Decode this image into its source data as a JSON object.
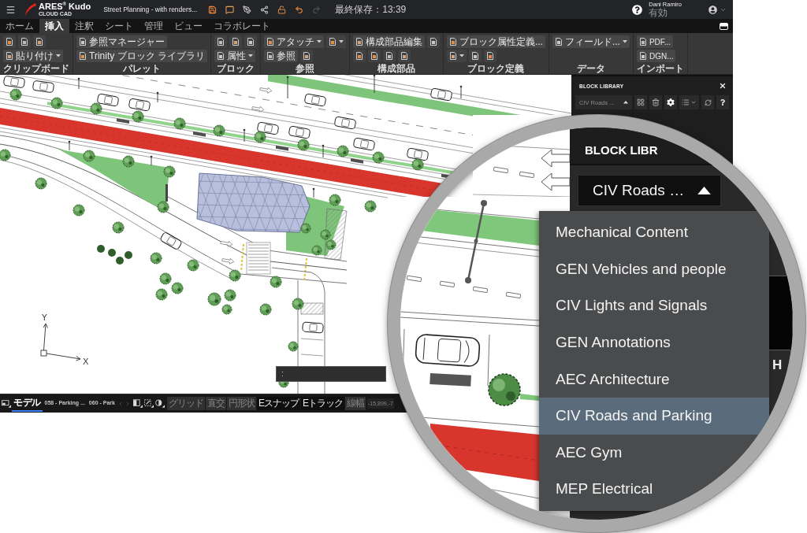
{
  "titlebar": {
    "logo_name": "ARES$^{®}$ Kudo",
    "logo_tagline": "CLOUD CAD",
    "document_title": "Street Planning - with renders...",
    "quick_actions": [
      {
        "kind": "save",
        "disabled": false
      },
      {
        "kind": "comment",
        "disabled": false
      },
      {
        "kind": "markup",
        "disabled": false
      },
      {
        "kind": "share",
        "disabled": false
      },
      {
        "kind": "unlock",
        "disabled": false
      },
      {
        "kind": "undo",
        "disabled": false
      },
      {
        "kind": "redo",
        "disabled": true
      }
    ],
    "last_saved": "最終保存：13:39",
    "user_name": "Dani Ramiro",
    "user_status": "有効"
  },
  "ribbon": {
    "tabs": [
      {
        "label": "ホーム",
        "selected": false
      },
      {
        "label": "挿入",
        "selected": true
      },
      {
        "label": "注釈",
        "selected": false
      },
      {
        "label": "シート",
        "selected": false
      },
      {
        "label": "管理",
        "selected": false
      },
      {
        "label": "ビュー",
        "selected": false
      },
      {
        "label": "コラボレート",
        "selected": false
      }
    ],
    "groups": [
      {
        "label": "クリップボード",
        "rows": [
          [
            {
              "dropdown": false
            },
            {
              "dropdown": false
            },
            {
              "dropdown": false
            }
          ],
          [
            {
              "label": "貼り付け",
              "dropdown": true
            }
          ]
        ]
      },
      {
        "label": "パレット",
        "rows": [
          [
            {
              "label": "参照マネージャー",
              "dropdown": false
            }
          ],
          [
            {
              "label": "Trinity ブロック ライブラリ",
              "dropdown": false
            }
          ]
        ]
      },
      {
        "label": "ブロック",
        "rows": [
          [
            {
              "dropdown": false
            },
            {
              "dropdown": false
            },
            {
              "dropdown": false
            }
          ],
          [
            {
              "label": "属性",
              "dropdown": true
            }
          ]
        ]
      },
      {
        "label": "参照",
        "rows": [
          [
            {
              "label": "アタッチ",
              "dropdown": true
            },
            {
              "dropdown": true
            }
          ],
          [
            {
              "label": "参照",
              "dropdown": false
            },
            {
              "dropdown": false
            }
          ]
        ]
      },
      {
        "label": "構成部品",
        "rows": [
          [
            {
              "label": "構成部品編集",
              "dropdown": false
            },
            {
              "dropdown": false
            }
          ],
          [
            {
              "dropdown": false
            },
            {
              "dropdown": false
            },
            {
              "dropdown": false
            },
            {
              "dropdown": false
            }
          ]
        ]
      },
      {
        "label": "ブロック定義",
        "rows": [
          [
            {
              "label": "ブロック属性定義...",
              "dropdown": false
            }
          ],
          [
            {
              "dropdown": true
            },
            {
              "dropdown": false
            },
            {
              "dropdown": false
            }
          ]
        ]
      },
      {
        "label": "データ",
        "rows": [
          [
            {
              "label": "フィールド...",
              "dropdown": true
            }
          ]
        ]
      },
      {
        "label": "インポート",
        "rows": [
          [
            {
              "label": "PDF...",
              "dropdown": false
            }
          ],
          [
            {
              "label": "DGN...",
              "dropdown": false
            }
          ]
        ]
      }
    ]
  },
  "drawing": {
    "axis_y": "Y",
    "axis_x": "X",
    "command_line": {
      "prompt": ":"
    }
  },
  "block_library": {
    "title": "BLOCK LIBRARY",
    "library_select": "CIV Roads ...",
    "expanded": true
  },
  "status_bar": {
    "layout_tabs": [
      {
        "label": "モデル",
        "selected": true
      },
      {
        "label": "058 - Parking ...",
        "selected": false
      },
      {
        "label": "060 - Park",
        "selected": false
      }
    ],
    "toggles": [
      {
        "label": "グリッド",
        "on": false
      },
      {
        "label": "直交",
        "on": false
      },
      {
        "label": "円形状",
        "on": false
      },
      {
        "label": "Eスナップ",
        "on": true
      },
      {
        "label": "Eトラック",
        "on": true
      },
      {
        "label": "線幅",
        "on": false
      }
    ],
    "coordinates": "-15,899,-7"
  },
  "magnifier": {
    "panel_title": "BLOCK LIBR",
    "library_select": "CIV Roads …",
    "expanded": true,
    "libraries": [
      {
        "label": "Mechanical Content",
        "selected": false
      },
      {
        "label": "GEN Vehicles and people",
        "selected": false
      },
      {
        "label": "CIV Lights and Signals",
        "selected": false
      },
      {
        "label": "GEN Annotations",
        "selected": false
      },
      {
        "label": "AEC Architecture",
        "selected": false
      },
      {
        "label": "CIV Roads and Parking",
        "selected": true
      },
      {
        "label": "AEC Gym",
        "selected": false
      },
      {
        "label": "MEP Electrical",
        "selected": false
      }
    ],
    "block_label": "H"
  }
}
